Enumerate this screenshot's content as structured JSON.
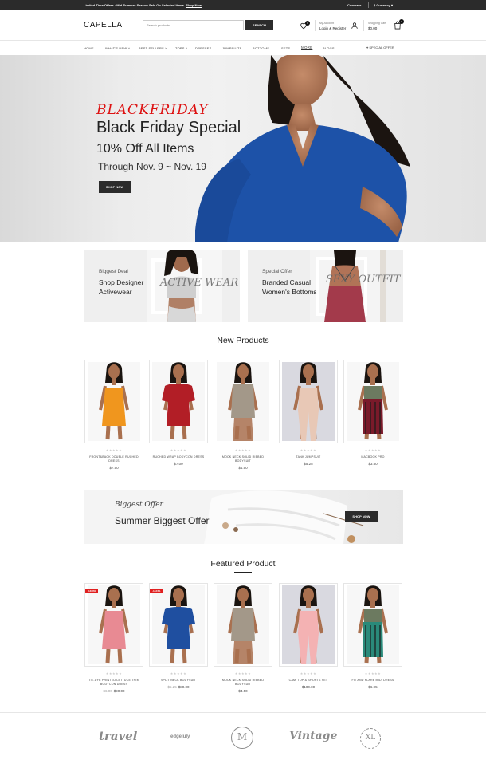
{
  "topbar": {
    "promo": "Limited-Time Offers : Mid-Summer Season Sale On Selected Items -",
    "promo_link": "Shop Now",
    "compare": "Compare",
    "currency": "$ Currency"
  },
  "header": {
    "logo": "CAPELLA",
    "search_placeholder": "Search products...",
    "search_button": "SEARCH",
    "wishlist_count": "0",
    "account_label": "My Account",
    "account_link": "Login & Register",
    "cart_label": "Shopping Cart",
    "cart_total": "$0.00",
    "cart_count": "0"
  },
  "nav": {
    "items": [
      "HOME",
      "WHAT'S NEW",
      "BEST SELLERS",
      "TOPS",
      "DRESSES",
      "JUMPSUITS",
      "BOTTOMS",
      "SETS",
      "MORE",
      "BLOGS"
    ],
    "special": "SPECIAL OFFER"
  },
  "hero": {
    "script": "BLACKFRIDAY",
    "title": "Black Friday Special",
    "subtitle": "10% Off All Items",
    "dates": "Through Nov. 9 ~ Nov. 19",
    "button": "SHOP NOW"
  },
  "banners": [
    {
      "label": "Biggest Deal",
      "title": "Shop Designer Activewear",
      "script": "ACTIVE WEAR"
    },
    {
      "label": "Special Offer",
      "title": "Branded Casual Women's Bottoms",
      "script": "SEXY OUTFIT"
    }
  ],
  "new_products": {
    "title": "New Products",
    "items": [
      {
        "name": "FRONT&BACK DOUBLE RUCHED DRESS",
        "price": "$7.50",
        "color": "#f0961e"
      },
      {
        "name": "RUCHED WRAP BODYCON DRESS",
        "price": "$7.00",
        "color": "#b21e26"
      },
      {
        "name": "MOCK NECK SOLID RIBBED BODYSUIT",
        "price": "$4.50",
        "color": "#a39889"
      },
      {
        "name": "TANK JUMPSUIT",
        "price": "$5.25",
        "color": "#e8c8b6"
      },
      {
        "name": "MACBOOK PRO",
        "price": "$3.50",
        "color": "#7a1a2a"
      }
    ]
  },
  "summer": {
    "script": "Biggest Offer",
    "title": "Summer Biggest Offer",
    "button": "SHOP NOW"
  },
  "featured": {
    "title": "Featured Product",
    "items": [
      {
        "name": "TIE-DYE PRINTED LETTUCE TRIM BODYCON DRESS",
        "old_price": "$6.00",
        "price": "$90.00",
        "sale": "-1400%",
        "color": "#e88a93"
      },
      {
        "name": "SPLIT NECK BODYSUIT",
        "old_price": "$5.25",
        "price": "$80.00",
        "sale": "-1424%",
        "color": "#1f4fa0"
      },
      {
        "name": "MOCK NECK SOLID RIBBED BODYSUIT",
        "old_price": "",
        "price": "$4.50",
        "sale": "",
        "color": "#a39889"
      },
      {
        "name": "CAMI TOP & SHORTS SET",
        "old_price": "",
        "price": "$100.00",
        "sale": "",
        "color": "#f4b2b3"
      },
      {
        "name": "FIT AND FLARE MIDI DRESS",
        "old_price": "",
        "price": "$6.95",
        "sale": "",
        "color": "#2a8a7a"
      }
    ]
  },
  "brands": [
    "travel",
    "edgeluly",
    "M",
    "Vintage",
    "XL"
  ],
  "rating": "★★★★★"
}
